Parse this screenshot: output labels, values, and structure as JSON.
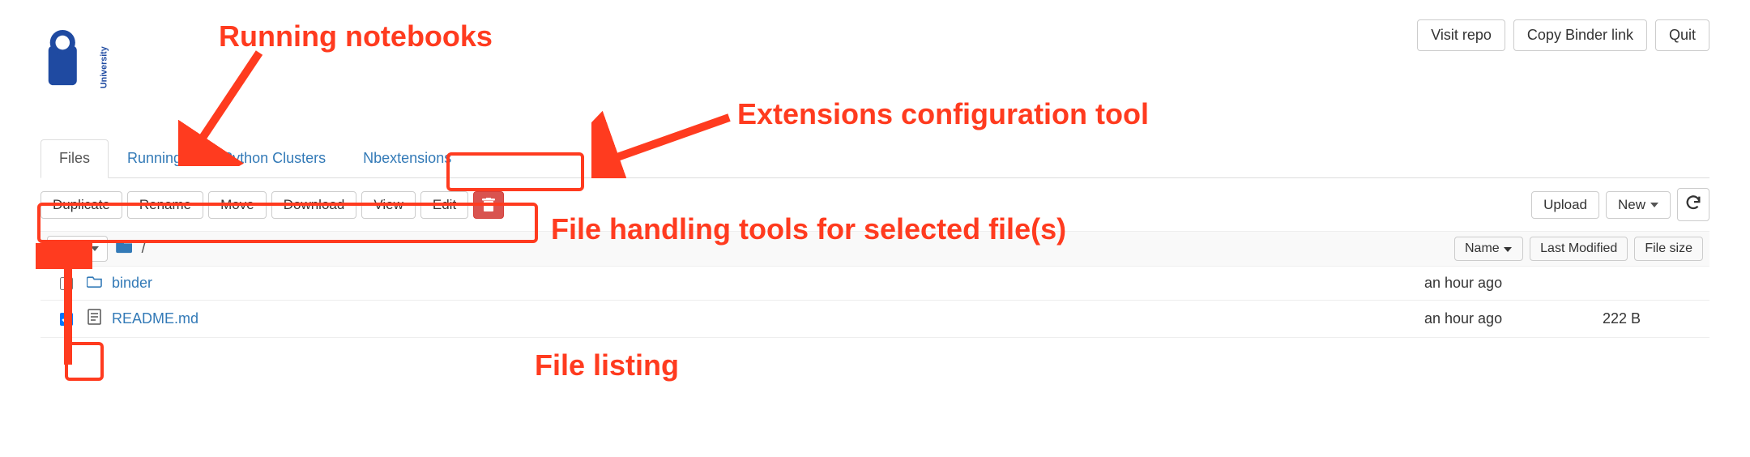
{
  "logo": {
    "brand": "The Open University"
  },
  "header_buttons": {
    "visit_repo": "Visit repo",
    "copy_binder": "Copy Binder link",
    "quit": "Quit"
  },
  "tabs": {
    "files": "Files",
    "running": "Running",
    "ipython": "IPython Clusters",
    "nbext": "Nbextensions"
  },
  "file_actions": {
    "duplicate": "Duplicate",
    "rename": "Rename",
    "move": "Move",
    "download": "Download",
    "view": "View",
    "edit": "Edit"
  },
  "right_actions": {
    "upload": "Upload",
    "new": "New"
  },
  "breadcrumb": {
    "selected_count": "1",
    "path_sep": "/"
  },
  "sort": {
    "name": "Name",
    "modified": "Last Modified",
    "size": "File size"
  },
  "files": [
    {
      "checked": false,
      "icon": "folder",
      "name": "binder",
      "modified": "an hour ago",
      "size": ""
    },
    {
      "checked": true,
      "icon": "file",
      "name": "README.md",
      "modified": "an hour ago",
      "size": "222 B"
    }
  ],
  "annotations": {
    "running": "Running notebooks",
    "ext": "Extensions configuration tool",
    "tools": "File handling tools for selected file(s)",
    "listing": "File listing"
  }
}
